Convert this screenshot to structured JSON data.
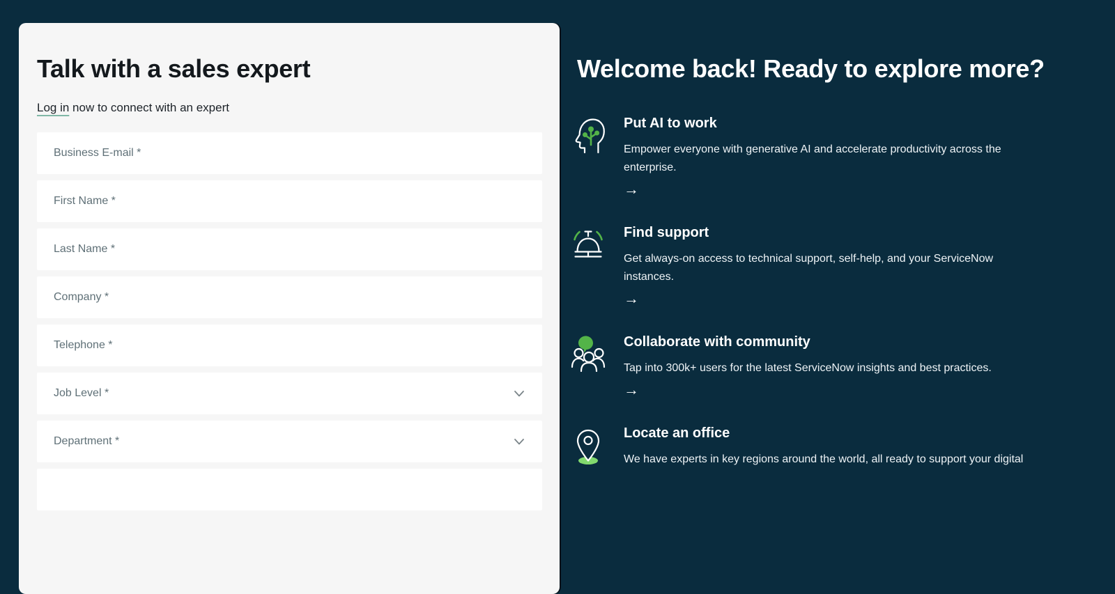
{
  "page": {
    "background_color": "#0a2c3e",
    "card_background_color": "#f6f6f6",
    "accent_green": "#53b448",
    "pin_base_green": "#82d96e",
    "login_underline_color": "#80b7a6"
  },
  "form_card": {
    "title": "Talk with a sales expert",
    "login_link_label": "Log in",
    "login_line_rest": " now to connect with an expert",
    "fields": [
      {
        "label": "Business E-mail *",
        "type": "text"
      },
      {
        "label": "First Name *",
        "type": "text"
      },
      {
        "label": "Last Name *",
        "type": "text"
      },
      {
        "label": "Company *",
        "type": "text"
      },
      {
        "label": "Telephone *",
        "type": "text"
      },
      {
        "label": "Job Level *",
        "type": "select"
      },
      {
        "label": "Department *",
        "type": "select"
      }
    ]
  },
  "welcome_panel": {
    "title": "Welcome back! Ready to explore more?",
    "arrow_glyph": "→",
    "features": [
      {
        "icon": "ai-head-icon",
        "title": "Put AI to work",
        "description": "Empower everyone with generative AI and accelerate productivity across the enterprise."
      },
      {
        "icon": "service-bell-icon",
        "title": "Find support",
        "description": "Get always-on access to technical support, self-help, and your ServiceNow instances."
      },
      {
        "icon": "community-people-icon",
        "title": "Collaborate with community",
        "description": "Tap into 300k+ users for the latest ServiceNow insights and best practices."
      },
      {
        "icon": "location-pin-icon",
        "title": "Locate an office",
        "description": "We have experts in key regions around the world, all ready to support your digital"
      }
    ]
  }
}
